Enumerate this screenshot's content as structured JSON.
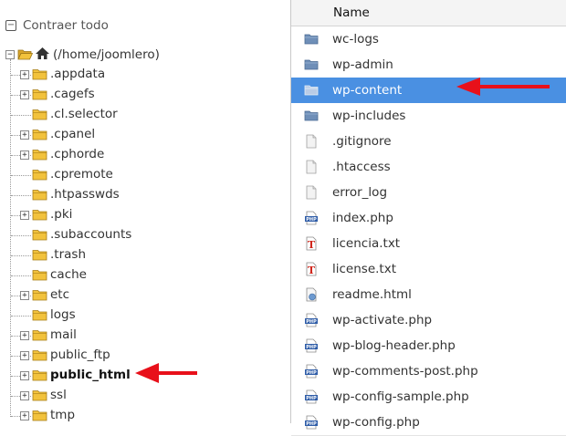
{
  "tree": {
    "collapse_label": "Contraer todo",
    "root_label": "(/home/joomlero)",
    "items": [
      {
        "label": ".appdata",
        "expandable": true
      },
      {
        "label": ".cagefs",
        "expandable": true
      },
      {
        "label": ".cl.selector",
        "expandable": false
      },
      {
        "label": ".cpanel",
        "expandable": true
      },
      {
        "label": ".cphorde",
        "expandable": true
      },
      {
        "label": ".cpremote",
        "expandable": false
      },
      {
        "label": ".htpasswds",
        "expandable": false
      },
      {
        "label": ".pki",
        "expandable": true
      },
      {
        "label": ".subaccounts",
        "expandable": false
      },
      {
        "label": ".trash",
        "expandable": false
      },
      {
        "label": "cache",
        "expandable": false
      },
      {
        "label": "etc",
        "expandable": true
      },
      {
        "label": "logs",
        "expandable": false
      },
      {
        "label": "mail",
        "expandable": true
      },
      {
        "label": "public_ftp",
        "expandable": true
      },
      {
        "label": "public_html",
        "expandable": true,
        "bold": true
      },
      {
        "label": "ssl",
        "expandable": true
      },
      {
        "label": "tmp",
        "expandable": true
      }
    ]
  },
  "file_list": {
    "column_name": "Name",
    "rows": [
      {
        "name": "wc-logs",
        "icon": "folder"
      },
      {
        "name": "wp-admin",
        "icon": "folder"
      },
      {
        "name": "wp-content",
        "icon": "folder",
        "selected": true
      },
      {
        "name": "wp-includes",
        "icon": "folder"
      },
      {
        "name": ".gitignore",
        "icon": "file"
      },
      {
        "name": ".htaccess",
        "icon": "file"
      },
      {
        "name": "error_log",
        "icon": "file"
      },
      {
        "name": "index.php",
        "icon": "php"
      },
      {
        "name": "licencia.txt",
        "icon": "text"
      },
      {
        "name": "license.txt",
        "icon": "text"
      },
      {
        "name": "readme.html",
        "icon": "html"
      },
      {
        "name": "wp-activate.php",
        "icon": "php"
      },
      {
        "name": "wp-blog-header.php",
        "icon": "php"
      },
      {
        "name": "wp-comments-post.php",
        "icon": "php"
      },
      {
        "name": "wp-config-sample.php",
        "icon": "php"
      },
      {
        "name": "wp-config.php",
        "icon": "php"
      }
    ]
  },
  "colors": {
    "selected_row": "#4a90e2",
    "arrow": "#e8101a",
    "folder": "#f2c23c"
  }
}
